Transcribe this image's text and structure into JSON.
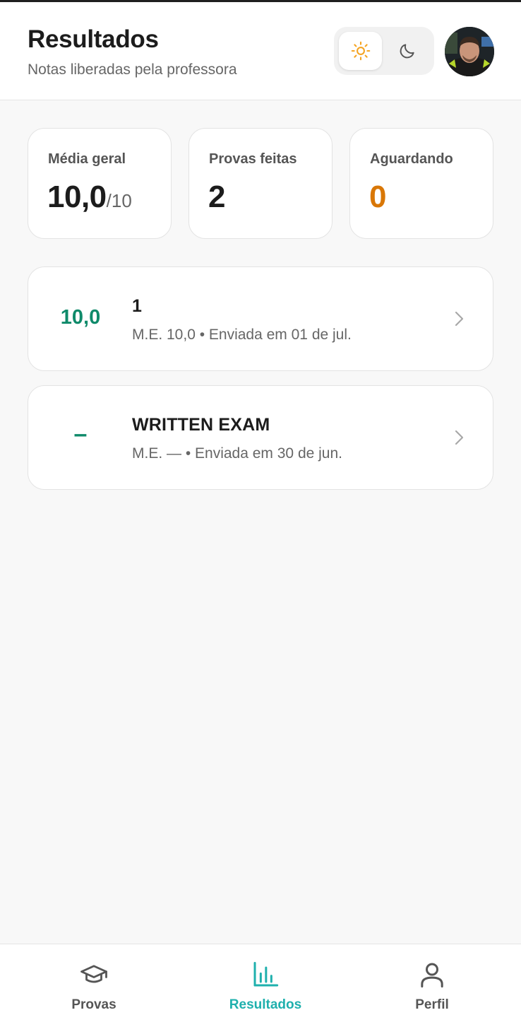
{
  "header": {
    "title": "Resultados",
    "subtitle": "Notas liberadas pela professora",
    "theme": {
      "selected": "light",
      "light_icon": "sun-icon",
      "dark_icon": "moon-icon"
    },
    "avatar_icon": "user-avatar"
  },
  "stats": [
    {
      "label": "Média geral",
      "value": "10,0",
      "suffix": "/10"
    },
    {
      "label": "Provas feitas",
      "value": "2"
    },
    {
      "label": "Aguardando",
      "value": "0"
    }
  ],
  "results": [
    {
      "grade": "10,0",
      "title": "1",
      "meta": "M.E. 10,0 • Enviada em 01 de jul."
    },
    {
      "grade": "–",
      "title": "WRITTEN EXAM",
      "meta": "M.E. — • Enviada em 30 de jun."
    }
  ],
  "nav": {
    "items": [
      {
        "label": "Provas",
        "icon": "graduation-cap-icon"
      },
      {
        "label": "Resultados",
        "icon": "bar-chart-icon",
        "active": true
      },
      {
        "label": "Perfil",
        "icon": "user-icon"
      }
    ]
  },
  "colors": {
    "accent": "#1fb0ad",
    "grade_green": "#0f8a6a",
    "warning_orange": "#d97706",
    "sun_orange": "#f5a524"
  }
}
